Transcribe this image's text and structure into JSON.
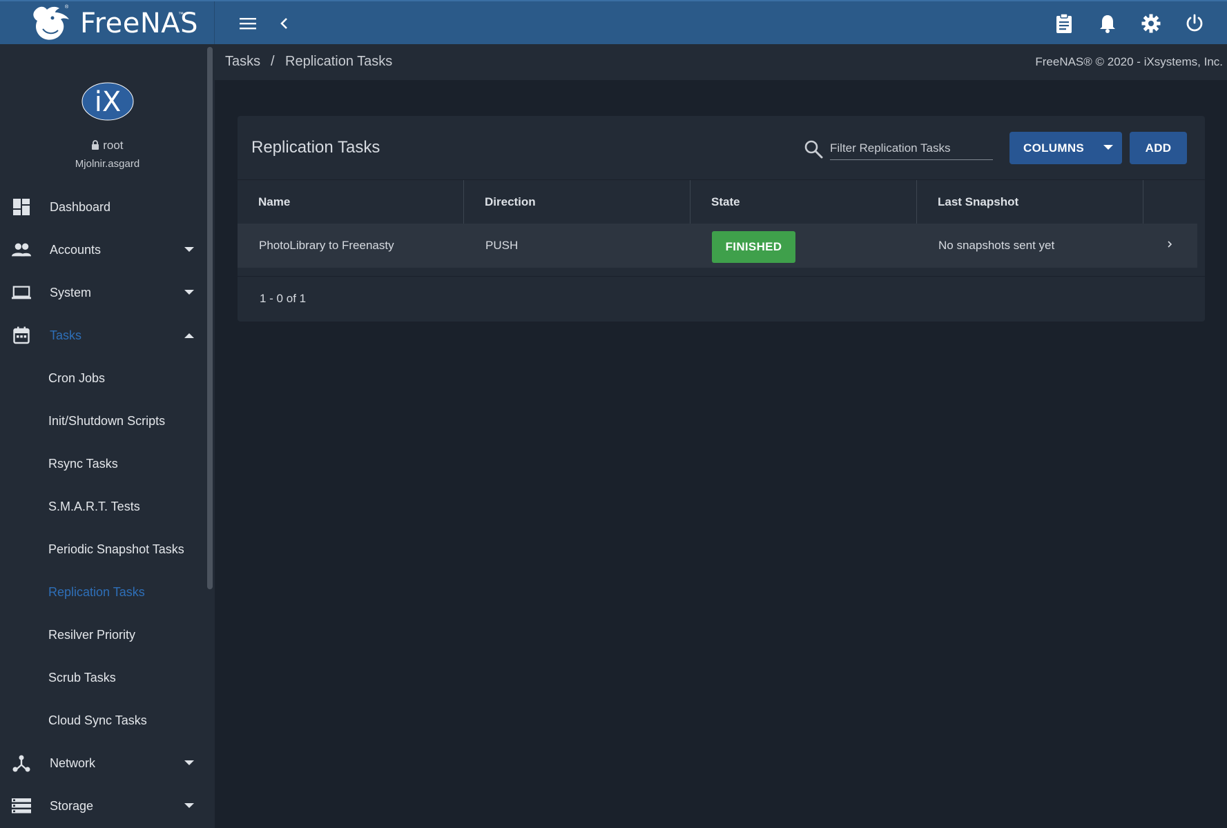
{
  "brand": {
    "name": "FreeNAS",
    "tm": "™",
    "reg": "®"
  },
  "topbar": {
    "menu_icon": "menu-icon",
    "back_icon": "chevron-left-icon",
    "right_icons": [
      "clipboard-icon",
      "bell-icon",
      "gear-icon",
      "power-icon"
    ]
  },
  "sidebar": {
    "avatar_text": "iX",
    "user": "root",
    "hostname": "Mjolnir.asgard",
    "items": [
      {
        "label": "Dashboard",
        "icon": "dashboard-icon"
      },
      {
        "label": "Accounts",
        "icon": "people-icon"
      },
      {
        "label": "System",
        "icon": "laptop-icon"
      },
      {
        "label": "Tasks",
        "icon": "calendar-icon"
      },
      {
        "label": "Network",
        "icon": "network-icon"
      },
      {
        "label": "Storage",
        "icon": "storage-icon"
      }
    ],
    "tasks_children": [
      "Cron Jobs",
      "Init/Shutdown Scripts",
      "Rsync Tasks",
      "S.M.A.R.T. Tests",
      "Periodic Snapshot Tasks",
      "Replication Tasks",
      "Resilver Priority",
      "Scrub Tasks",
      "Cloud Sync Tasks"
    ],
    "active_item": "Tasks",
    "active_child": "Replication Tasks"
  },
  "breadcrumb": {
    "parent": "Tasks",
    "separator": "/",
    "current": "Replication Tasks"
  },
  "copyright": "FreeNAS® © 2020 - iXsystems, Inc.",
  "card": {
    "title": "Replication Tasks",
    "search_placeholder": "Filter Replication Tasks",
    "search_value": "",
    "columns_label": "COLUMNS",
    "add_label": "ADD"
  },
  "table": {
    "columns": [
      "Name",
      "Direction",
      "State",
      "Last Snapshot"
    ],
    "rows": [
      {
        "name": "PhotoLibrary to Freenasty",
        "direction": "PUSH",
        "state": "FINISHED",
        "last_snapshot": "No snapshots sent yet"
      }
    ],
    "paginator": "1 - 0 of 1"
  },
  "colors": {
    "topbar": "#2b5a89",
    "sidebar": "#232b36",
    "background": "#1a212b",
    "accent": "#2e6fb8",
    "button": "#285693",
    "finished_badge": "#3fa04b"
  }
}
